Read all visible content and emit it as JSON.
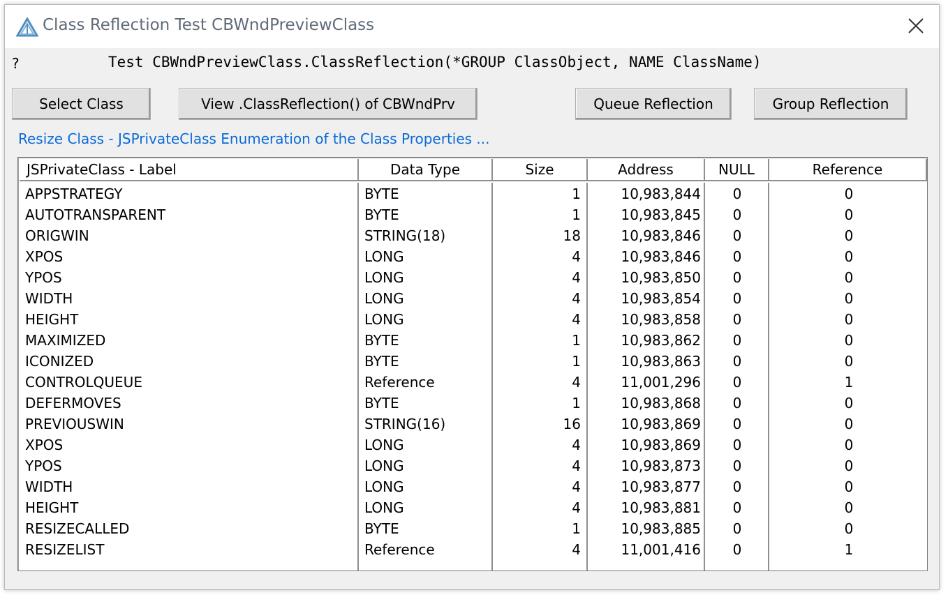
{
  "window": {
    "title": "Class Reflection Test CBWndPreviewClass",
    "help_mark": "?",
    "signature": "Test CBWndPreviewClass.ClassReflection(*GROUP ClassObject, NAME ClassName)"
  },
  "buttons": {
    "select_class": "Select Class",
    "view_reflection": "View .ClassReflection() of CBWndPrv",
    "queue_reflection": "Queue Reflection",
    "group_reflection": "Group Reflection"
  },
  "prompt": "Resize Class - JSPrivateClass Enumeration of the Class Properties ...",
  "table": {
    "headers": [
      "JSPrivateClass  -  Label",
      "Data Type",
      "Size",
      "Address",
      "NULL",
      "Reference"
    ],
    "rows": [
      [
        "APPSTRATEGY",
        "BYTE",
        "1",
        "10,983,844",
        "0",
        "0"
      ],
      [
        "AUTOTRANSPARENT",
        "BYTE",
        "1",
        "10,983,845",
        "0",
        "0"
      ],
      [
        "ORIGWIN",
        "STRING(18)",
        "18",
        "10,983,846",
        "0",
        "0"
      ],
      [
        "XPOS",
        "LONG",
        "4",
        "10,983,846",
        "0",
        "0"
      ],
      [
        "YPOS",
        "LONG",
        "4",
        "10,983,850",
        "0",
        "0"
      ],
      [
        "WIDTH",
        "LONG",
        "4",
        "10,983,854",
        "0",
        "0"
      ],
      [
        "HEIGHT",
        "LONG",
        "4",
        "10,983,858",
        "0",
        "0"
      ],
      [
        "MAXIMIZED",
        "BYTE",
        "1",
        "10,983,862",
        "0",
        "0"
      ],
      [
        "ICONIZED",
        "BYTE",
        "1",
        "10,983,863",
        "0",
        "0"
      ],
      [
        "CONTROLQUEUE",
        "Reference",
        "4",
        "11,001,296",
        "0",
        "1"
      ],
      [
        "DEFERMOVES",
        "BYTE",
        "1",
        "10,983,868",
        "0",
        "0"
      ],
      [
        "PREVIOUSWIN",
        "STRING(16)",
        "16",
        "10,983,869",
        "0",
        "0"
      ],
      [
        "XPOS",
        "LONG",
        "4",
        "10,983,869",
        "0",
        "0"
      ],
      [
        "YPOS",
        "LONG",
        "4",
        "10,983,873",
        "0",
        "0"
      ],
      [
        "WIDTH",
        "LONG",
        "4",
        "10,983,877",
        "0",
        "0"
      ],
      [
        "HEIGHT",
        "LONG",
        "4",
        "10,983,881",
        "0",
        "0"
      ],
      [
        "RESIZECALLED",
        "BYTE",
        "1",
        "10,983,885",
        "0",
        "0"
      ],
      [
        "RESIZELIST",
        "Reference",
        "4",
        "11,001,416",
        "0",
        "1"
      ]
    ]
  },
  "colors": {
    "accent_link": "#0a6ad8",
    "icon": "#4f8fbf"
  }
}
